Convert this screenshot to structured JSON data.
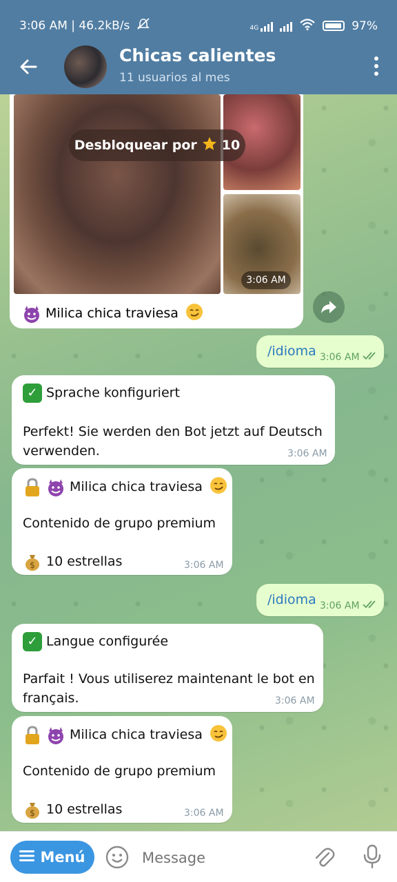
{
  "status": {
    "time_speed": "3:06 AM | 46.2kB/s",
    "network": "4G",
    "battery": "97",
    "battery_level": 0.97
  },
  "header": {
    "title": "Chicas calientes",
    "subtitle": "11 usuarios al mes"
  },
  "media": {
    "unlock_label": "Desbloquear por",
    "unlock_amount": "10",
    "time": "3:06 AM",
    "caption": "Milica chica traviesa"
  },
  "messages": [
    {
      "text": "/idioma",
      "time": "3:06 AM"
    },
    {
      "title": "Sprache konfiguriert",
      "body": "Perfekt! Sie werden den Bot jetzt auf Deutsch verwenden.",
      "time": "3:06 AM"
    },
    {
      "title": "Milica chica traviesa",
      "body": "Contenido de grupo premium",
      "price": "10 estrellas",
      "time": "3:06 AM"
    },
    {
      "text": "/idioma",
      "time": "3:06 AM"
    },
    {
      "title": "Langue configurée",
      "body": "Parfait ! Vous utiliserez maintenant le bot en français.",
      "time": "3:06 AM"
    },
    {
      "title": "Milica chica traviesa",
      "body": "Contenido de grupo premium",
      "price": "10 estrellas",
      "time": "3:06 AM"
    }
  ],
  "composer": {
    "menu_label": "Menú",
    "placeholder": "Message"
  },
  "colors": {
    "header": "#517da2",
    "outgoing_bubble": "#e6fecd",
    "menu_button": "#3b96e2"
  },
  "icons": [
    "back-arrow-icon",
    "more-vert-icon",
    "star-icon",
    "share-icon",
    "double-check-icon",
    "check-mark-icon",
    "devil-icon",
    "lock-icon",
    "money-bag-icon",
    "menu-icon",
    "emoji-icon",
    "attach-icon",
    "mic-icon",
    "mute-icon",
    "wifi-icon",
    "battery-icon"
  ]
}
